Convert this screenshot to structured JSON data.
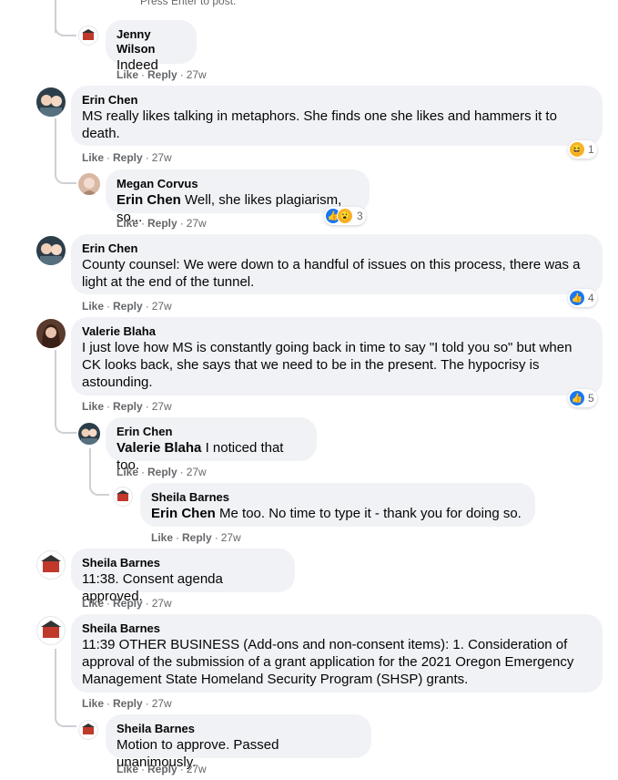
{
  "top_hint": "Press Enter to post.",
  "actions": {
    "like": "Like",
    "reply": "Reply",
    "dot": "·"
  },
  "comments": [
    {
      "author": "Jenny Wilson",
      "mention": "",
      "text": "Indeed",
      "time": "27w"
    },
    {
      "author": "Erin Chen",
      "mention": "",
      "text": "MS really likes talking in metaphors. She finds one she likes and hammers it to death.",
      "time": "27w",
      "reaction_count": "1",
      "reaction_icons": [
        "haha-icon"
      ]
    },
    {
      "author": "Megan Corvus",
      "mention": "Erin Chen",
      "text": "Well, she likes plagiarism, so...",
      "time": "27w",
      "reaction_count": "3",
      "reaction_icons": [
        "like-icon",
        "wow-icon"
      ]
    },
    {
      "author": "Erin Chen",
      "mention": "",
      "text": "County counsel: We were down to a handful of issues on this process, there was a light at the end of the tunnel.",
      "time": "27w",
      "reaction_count": "4",
      "reaction_icons": [
        "like-icon"
      ]
    },
    {
      "author": "Valerie Blaha",
      "mention": "",
      "text": "I just love how MS is constantly going back in time to say \"I told you so\" but when CK looks back, she says that we need to be in the present. The hypocrisy is astounding.",
      "time": "27w",
      "reaction_count": "5",
      "reaction_icons": [
        "like-icon"
      ]
    },
    {
      "author": "Erin Chen",
      "mention": "Valerie Blaha",
      "text": "I noticed that too.",
      "time": "27w"
    },
    {
      "author": "Sheila Barnes",
      "mention": "Erin Chen",
      "text": "Me too. No time to type it - thank you for doing so.",
      "time": "27w"
    },
    {
      "author": "Sheila Barnes",
      "mention": "",
      "text": "11:38. Consent agenda approved.",
      "time": "27w"
    },
    {
      "author": "Sheila Barnes",
      "mention": "",
      "text": "11:39 OTHER BUSINESS (Add-ons and non-consent items): 1. Consideration of approval of the submission of a grant application for the 2021 Oregon Emergency Management State Homeland Security Program (SHSP) grants.",
      "time": "27w"
    },
    {
      "author": "Sheila Barnes",
      "mention": "",
      "text": "Motion to approve. Passed unanimously.",
      "time": "27w"
    }
  ],
  "colors": {
    "bubble": "#f0f2f5",
    "meta": "#65676b",
    "like_blue": "#1877f2",
    "thread_line": "#ced0d4"
  }
}
